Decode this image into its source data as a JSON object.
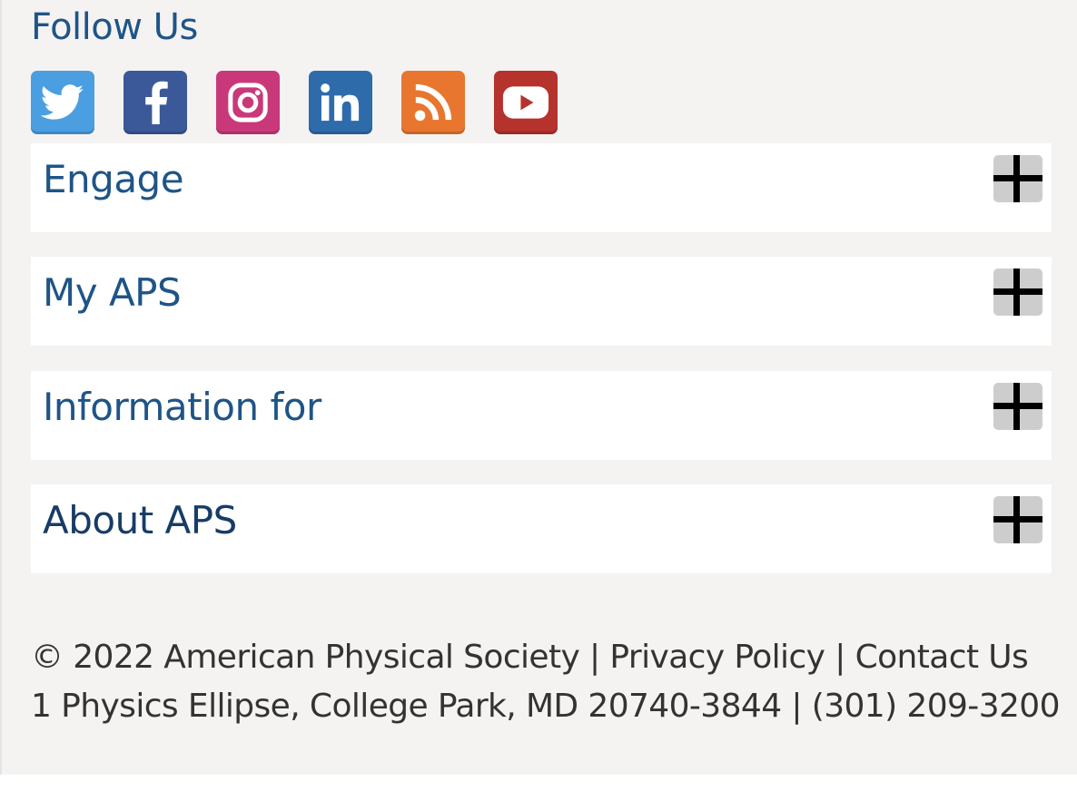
{
  "follow": {
    "title": "Follow Us",
    "icons": [
      {
        "name": "twitter-icon",
        "color": "#4b9fe1"
      },
      {
        "name": "facebook-icon",
        "color": "#3b5998"
      },
      {
        "name": "instagram-icon",
        "color": "#c9397a"
      },
      {
        "name": "linkedin-icon",
        "color": "#2e6bab"
      },
      {
        "name": "rss-icon",
        "color": "#e8762f"
      },
      {
        "name": "youtube-icon",
        "color": "#b6322c"
      }
    ]
  },
  "panels": [
    {
      "label": "Engage",
      "expand_icon": "plus-icon"
    },
    {
      "label": "My APS",
      "expand_icon": "plus-icon"
    },
    {
      "label": "Information for",
      "expand_icon": "plus-icon"
    },
    {
      "label": "About APS",
      "expand_icon": "plus-icon"
    }
  ],
  "legal": {
    "copyright": "© 2022 American Physical Society",
    "separator": "|",
    "privacy": "Privacy Policy",
    "contact": "Contact Us",
    "address": "1 Physics Ellipse, College Park, MD 20740-3844",
    "phone": "(301) 209-3200"
  },
  "colors": {
    "heading": "#1f5487",
    "background": "#f4f3f2",
    "panel": "#ffffff",
    "toggle": "#cdcdcd"
  }
}
